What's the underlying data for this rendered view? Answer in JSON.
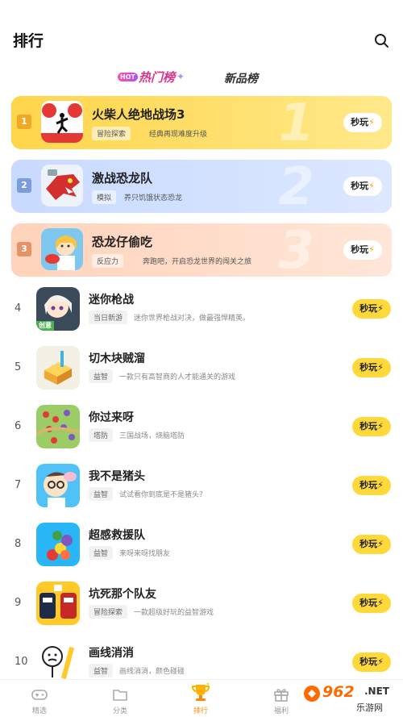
{
  "header": {
    "title": "排行",
    "search_icon": "search-icon"
  },
  "tabs": {
    "hot_badge": "HOT",
    "hot_label": "热门榜",
    "new_label": "新品榜"
  },
  "top_items": [
    {
      "rank": "1",
      "big_rank": "1",
      "name": "火柴人绝地战场3",
      "tag": "冒险探索",
      "desc": "经典再现难度升级",
      "button": "秒玩"
    },
    {
      "rank": "2",
      "big_rank": "2",
      "name": "激战恐龙队",
      "tag": "模拟",
      "desc": "养只饥饿状态恐龙",
      "button": "秒玩"
    },
    {
      "rank": "3",
      "big_rank": "3",
      "name": "恐龙仔偷吃",
      "tag": "反应力",
      "desc": "奔跑吧，开启恐龙世界的闯关之旅",
      "button": "秒玩"
    }
  ],
  "list_items": [
    {
      "rank": "4",
      "name": "迷你枪战",
      "tag": "当日新游",
      "desc": "迷你世界枪战对决，做最强悍精英。",
      "button": "秒玩",
      "icon_label": "创意"
    },
    {
      "rank": "5",
      "name": "切木块贼溜",
      "tag": "益智",
      "desc": "一款只有高智商的人才能通关的游戏",
      "button": "秒玩"
    },
    {
      "rank": "6",
      "name": "你过来呀",
      "tag": "塔防",
      "desc": "三国战场，烧脑塔防",
      "button": "秒玩"
    },
    {
      "rank": "7",
      "name": "我不是猪头",
      "tag": "益智",
      "desc": "试试看你到底是不是猪头？",
      "button": "秒玩"
    },
    {
      "rank": "8",
      "name": "超感救援队",
      "tag": "益智",
      "desc": "来呀来呀找朋友",
      "button": "秒玩"
    },
    {
      "rank": "9",
      "name": "坑死那个队友",
      "tag": "冒险探索",
      "desc": "一款超级好玩的益智游戏",
      "button": "秒玩"
    },
    {
      "rank": "10",
      "name": "画线消消",
      "tag": "益智",
      "desc": "画线消消，颜色碰碰",
      "button": "秒玩"
    }
  ],
  "bottom_nav": [
    {
      "label": "精选",
      "icon": "gamepad-icon"
    },
    {
      "label": "分类",
      "icon": "folder-icon"
    },
    {
      "label": "排行",
      "icon": "trophy-icon",
      "active": true
    },
    {
      "label": "福利",
      "icon": "gift-icon"
    }
  ],
  "watermark": {
    "number": "962",
    "suffix": ".NET",
    "text": "乐游网"
  },
  "colors": {
    "accent": "#ffd93a",
    "active_nav": "#ff8a00",
    "hot": "#e0338a"
  }
}
